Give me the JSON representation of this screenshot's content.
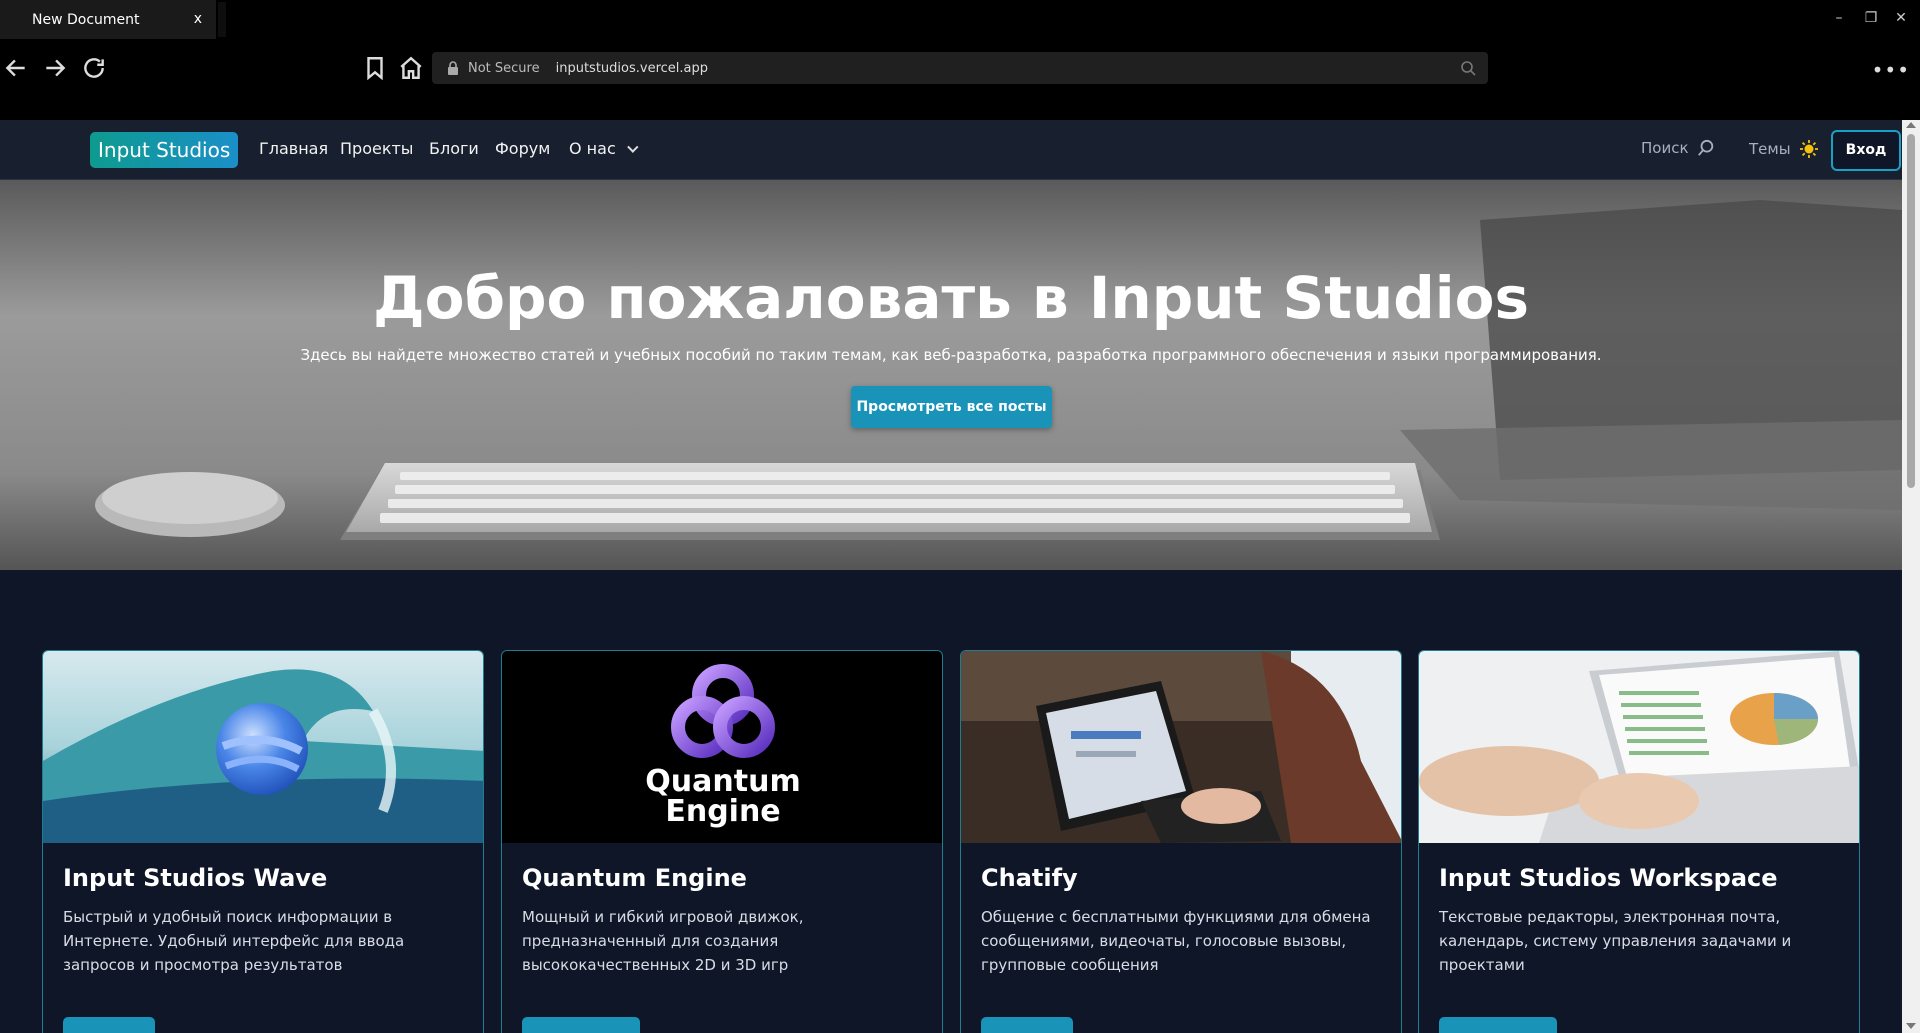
{
  "browser": {
    "tab_title": "New Document",
    "tab_close": "x",
    "security_label": "Not Secure",
    "url": "inputstudios.vercel.app",
    "more": "•••",
    "window_min": "–",
    "window_restore": "❐",
    "window_close": "✕"
  },
  "site_nav": {
    "brand": "Input Studios",
    "links": [
      "Главная",
      "Проекты",
      "Блоги",
      "Форум",
      "О нас"
    ],
    "search_label": "Поиск",
    "themes_label": "Темы",
    "login_label": "Вход"
  },
  "hero": {
    "title": "Добро пожаловать в Input Studios",
    "subtitle": "Здесь вы найдете множество статей и учебных пособий по таким темам, как веб-разработка, разработка программного обеспечения и языки программирования.",
    "button": "Просмотреть все посты"
  },
  "cards": [
    {
      "title": "Input Studios Wave",
      "description": "Быстрый и удобный поиск информации в Интернете. Удобный интерфейс для ввода запросов и просмотра результатов"
    },
    {
      "title": "Quantum Engine",
      "description": "Мощный и гибкий игровой движок, предназначенный для создания высококачественных 2D и 3D игр",
      "logo_line1": "Quantum",
      "logo_line2": "Engine"
    },
    {
      "title": "Chatify",
      "description": "Общение с бесплатными функциями для обмена сообщениями, видеочаты, голосовые вызовы, групповые сообщения"
    },
    {
      "title": "Input Studios Workspace",
      "description": "Текстовые редакторы, электронная почта, календарь, систему управления задачами и проектами"
    }
  ],
  "colors": {
    "accent": "#1a93b8",
    "page_bg": "#0f1628",
    "nav_bg": "#18202f",
    "card_border": "#1e7e90"
  }
}
